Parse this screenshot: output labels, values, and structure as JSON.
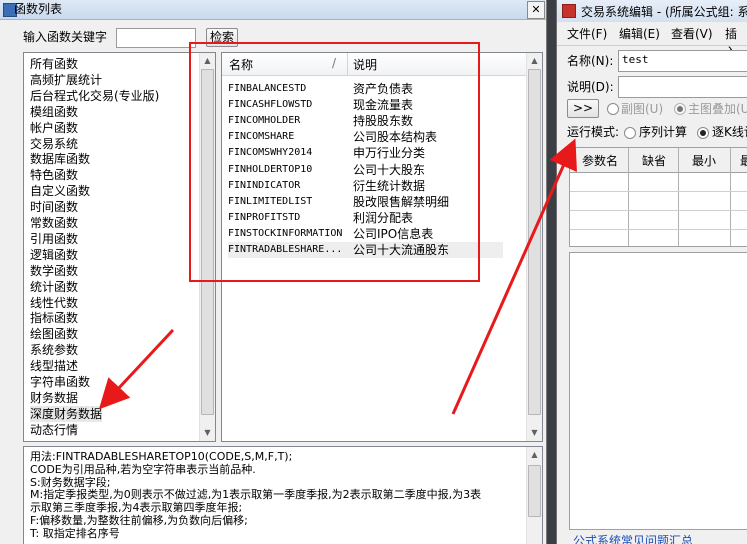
{
  "left_dialog": {
    "title": "函数列表",
    "close_glyph": "✕",
    "search_label": "输入函数关键字",
    "search_value": "",
    "search_button": "检索",
    "categories": [
      "所有函数",
      "高频扩展统计",
      "后台程式化交易(专业版)",
      "模组函数",
      "帐户函数",
      "交易系统",
      "数据库函数",
      "特色函数",
      "自定义函数",
      "时间函数",
      "常数函数",
      "引用函数",
      "逻辑函数",
      "数学函数",
      "统计函数",
      "线性代数",
      "指标函数",
      "绘图函数",
      "系统参数",
      "线型描述",
      "字符串函数",
      "财务数据",
      "深度财务数据",
      "动态行情"
    ],
    "selected_category": "深度财务数据",
    "table_headers": {
      "name": "名称",
      "sort_glyph": "/",
      "desc": "说明"
    },
    "functions": [
      {
        "name": "FINBALANCESTD",
        "desc": "资产负债表"
      },
      {
        "name": "FINCASHFLOWSTD",
        "desc": "现金流量表"
      },
      {
        "name": "FINCOMHOLDER",
        "desc": "持股股东数"
      },
      {
        "name": "FINCOMSHARE",
        "desc": "公司股本结构表"
      },
      {
        "name": "FINCOMSWHY2014",
        "desc": "申万行业分类"
      },
      {
        "name": "FINHOLDERTOP10",
        "desc": "公司十大股东"
      },
      {
        "name": "FININDICATOR",
        "desc": "衍生统计数据"
      },
      {
        "name": "FINLIMITEDLIST",
        "desc": "股改限售解禁明细"
      },
      {
        "name": "FINPROFITSTD",
        "desc": "利润分配表"
      },
      {
        "name": "FINSTOCKINFORMATION",
        "desc": "公司IPO信息表"
      },
      {
        "name": "FINTRADABLESHARE...",
        "desc": "公司十大流通股东"
      }
    ],
    "usage_lines": [
      "用法:FINTRADABLESHARETOP10(CODE,S,M,F,T);",
      "CODE为引用品种,若为空字符串表示当前品种.",
      "S:财务数据字段;",
      "M:指定季报类型,为0则表示不做过滤,为1表示取第一季度季报,为2表示取第二季度中报,为3表",
      "示取第三季度季报,为4表示取第四季度年报;",
      "F:偏移数量,为整数往前偏移,为负数向后偏移;",
      "T: 取指定排名序号"
    ]
  },
  "right_window": {
    "title": "交易系统编辑 - (所属公式组: 系",
    "menu": [
      "文件(F)",
      "编辑(E)",
      "查看(V)",
      "插入"
    ],
    "name_label": "名称(N):",
    "name_value": "test",
    "desc_label": "说明(D):",
    "desc_value": "",
    "expand_button": ">>",
    "opt_subchart": "副图(U)",
    "opt_overlay": "主图叠加(U",
    "run_mode_label": "运行模式:",
    "run_serial": "序列计算",
    "run_bar": "逐K线计",
    "param_headers": [
      "参数名",
      "缺省",
      "最小",
      "最"
    ],
    "bottom_link": "公式系统常见问题汇总"
  }
}
